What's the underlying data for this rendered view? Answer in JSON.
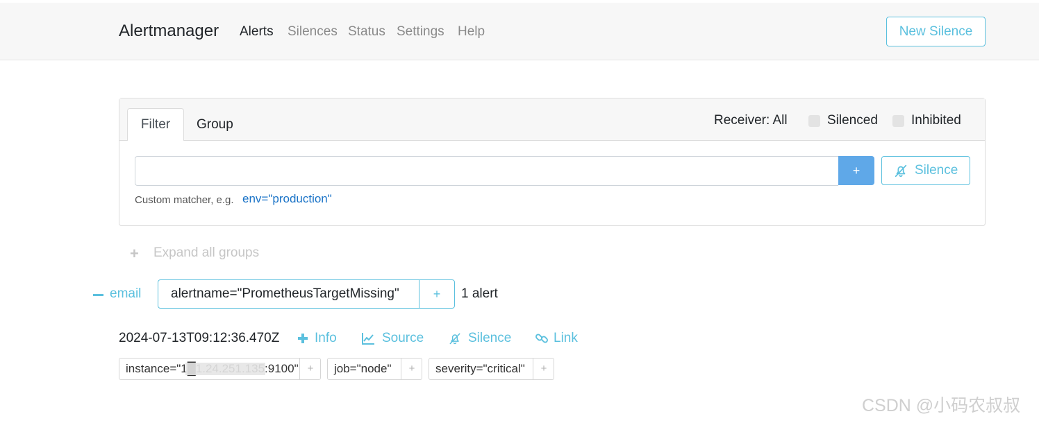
{
  "navbar": {
    "brand": "Alertmanager",
    "links": [
      "Alerts",
      "Silences",
      "Status",
      "Settings",
      "Help"
    ],
    "new_silence_label": "New Silence"
  },
  "filter_card": {
    "tabs": [
      "Filter",
      "Group"
    ],
    "receiver_label": "Receiver: All",
    "silenced_label": "Silenced",
    "inhibited_label": "Inhibited",
    "input_value": "",
    "add_button": "+",
    "silence_button": "Silence",
    "helper_text": "Custom matcher, e.g.",
    "helper_example": "env=\"production\""
  },
  "expand_all": {
    "icon": "+",
    "label": "Expand all groups"
  },
  "group": {
    "toggle_label": "email",
    "matcher": "alertname=\"PrometheusTargetMissing\"",
    "matcher_add": "+",
    "count": "1 alert"
  },
  "alert": {
    "timestamp": "2024-07-13T09:12:36.470Z",
    "actions": [
      "Info",
      "Source",
      "Silence",
      "Link"
    ],
    "labels": [
      {
        "text": "instance=\"1█1.24.251.135:9100\"",
        "add": "+"
      },
      {
        "text": "job=\"node\"",
        "add": "+"
      },
      {
        "text": "severity=\"critical\"",
        "add": "+"
      }
    ]
  },
  "watermark": "CSDN @小码农叔叔",
  "colors": {
    "accent": "#5bc0de",
    "primary_button": "#5fa8e8",
    "navbar_bg": "#f7f7f7",
    "muted_text": "#8a8a8a"
  }
}
